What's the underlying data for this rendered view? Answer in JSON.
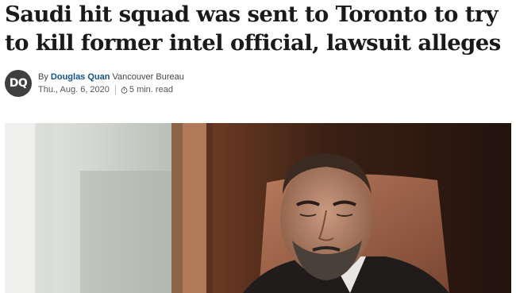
{
  "article": {
    "headline": "Saudi hit squad was sent to Toronto to try to kill former intel official, lawsuit alleges",
    "byline": {
      "avatar_initials": "DQ",
      "by_label": "By",
      "author": "Douglas Quan",
      "bureau": "Vancouver Bureau",
      "date": "Thu., Aug. 6, 2020",
      "read_time": "5 min. read"
    }
  },
  "colors": {
    "author_link": "#13538a",
    "avatar_bg": "#3f3f3f"
  }
}
